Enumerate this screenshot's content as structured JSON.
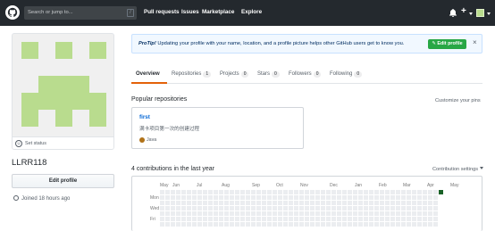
{
  "header": {
    "search_placeholder": "Search or jump to...",
    "search_shortcut": "/",
    "nav": [
      "Pull requests",
      "Issues",
      "Marketplace",
      "Explore"
    ],
    "icons": [
      "octocat-logo-icon",
      "bell-icon",
      "plus-icon",
      "avatar-icon"
    ]
  },
  "profile": {
    "set_status_label": "Set status",
    "username": "LLRR118",
    "edit_profile_label": "Edit profile",
    "joined_text": "Joined 18 hours ago",
    "avatar_color": "#b9dc8e"
  },
  "protip": {
    "lead": "ProTip!",
    "text": "Updating your profile with your name, location, and a profile picture helps other GitHub users get to know you.",
    "button_label": "Edit profile",
    "close_label": "×"
  },
  "tabs": [
    {
      "label": "Overview",
      "count": ""
    },
    {
      "label": "Repositories",
      "count": "1"
    },
    {
      "label": "Projects",
      "count": "0"
    },
    {
      "label": "Stars",
      "count": "0"
    },
    {
      "label": "Followers",
      "count": "0"
    },
    {
      "label": "Following",
      "count": "0"
    }
  ],
  "popular": {
    "title": "Popular repositories",
    "customize_label": "Customize your pins",
    "repo": {
      "name": "first",
      "description": "满卡项目第一次的创建过程",
      "language": "Java",
      "language_color": "#b07219"
    }
  },
  "contributions": {
    "title": "4 contributions in the last year",
    "settings_label": "Contribution settings",
    "months": [
      "May",
      "Jun",
      "Jul",
      "Aug",
      "Sep",
      "Oct",
      "Nov",
      "Dec",
      "Jan",
      "Feb",
      "Mar",
      "Apr",
      "May"
    ],
    "day_labels": [
      "Mon",
      "Wed",
      "Fri"
    ],
    "active_color": "#196127",
    "empty_color": "#ebedf0"
  }
}
